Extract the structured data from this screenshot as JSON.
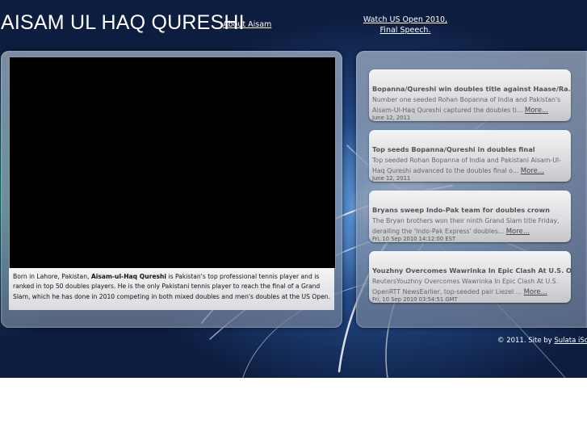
{
  "header": {
    "title": "AISAM UL HAQ QURESHI",
    "about_link": "About Aisam",
    "us_open_link_line1": "Watch US Open 2010,",
    "us_open_link_line2": "Final Speech."
  },
  "bio": {
    "prefix": "Born in Lahore, Pakistan,",
    "name": "Aisam-ul-Haq Qureshi",
    "text": "is Pakistan's top professional tennis player and is ranked in top 50 doubles players. He is the only Pakistani tennis player to reach the final of a Grand Slam, which he has done in 2010 competing in both mixed doubles and men's doubles at the US Open."
  },
  "news": [
    {
      "headline": "Bopanna/Qureshi win doubles title against Haase/Ra...",
      "summary": "Number one seeded Rohan Bopanna of India and Pakistan's Aisam-Ul-Haq Qureshi captured the doubles ti...",
      "more": "More...",
      "date": "June 12, 2011"
    },
    {
      "headline": "Top seeds Bopanna/Qureshi in doubles final",
      "summary": "Top seeded Rohan Bopanna of India and Pakistani Aisam-Ul-Haq Qureshi advanced to the doubles final o...",
      "more": "More...",
      "date": "June 12, 2011"
    },
    {
      "headline": "Bryans sweep Indo-Pak team for doubles crown",
      "summary": "The Bryan brothers won their ninth Grand Slam title Friday, derailing the 'Indo-Pak Express' doubles...",
      "more": "More...",
      "date": "Fri, 10 Sep 2010 14:12:00 EST"
    },
    {
      "headline": "Youzhny Overcomes Wawrinka In Epic Clash At U.S. O...",
      "summary": "ReutersYouzhny Overcomes Wawrinka In Epic Clash At U.S. OpenRTT NewsEarlier, top-seeded pair Liezel ...",
      "more": "More...",
      "date": "Fri, 10 Sep 2010 03:54:51 GMT"
    }
  ],
  "footer": {
    "copyright": "© 2011. Site by",
    "credit": "Sulata iSoft."
  }
}
